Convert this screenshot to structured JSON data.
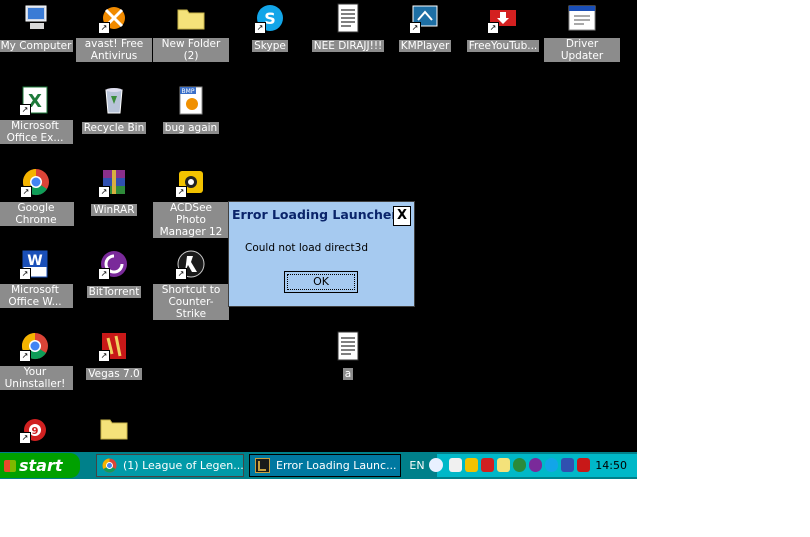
{
  "desktop": {
    "icons": [
      {
        "label": "My Computer",
        "icon": "my-computer-icon",
        "shortcut": false
      },
      {
        "label": "avast! Free Antivirus",
        "icon": "avast-icon",
        "shortcut": true
      },
      {
        "label": "New Folder (2)",
        "icon": "folder-icon",
        "shortcut": false
      },
      {
        "label": "Skype",
        "icon": "skype-icon",
        "shortcut": true
      },
      {
        "label": "NEE DIRAJJ!!!",
        "icon": "text-document-icon",
        "shortcut": false
      },
      {
        "label": "KMPlayer",
        "icon": "kmplayer-icon",
        "shortcut": true
      },
      {
        "label": "FreeYouTub...",
        "icon": "freeyoutube-icon",
        "shortcut": true
      },
      {
        "label": "Driver Updater",
        "icon": "driver-updater-icon",
        "shortcut": false
      },
      {
        "label": "Microsoft Office Ex...",
        "icon": "excel-icon",
        "shortcut": true
      },
      {
        "label": "Recycle Bin",
        "icon": "recycle-bin-icon",
        "shortcut": false
      },
      {
        "label": "bug again",
        "icon": "bmp-image-icon",
        "shortcut": false
      },
      {
        "label": "Google Chrome",
        "icon": "chrome-icon",
        "shortcut": true
      },
      {
        "label": "WinRAR",
        "icon": "winrar-icon",
        "shortcut": true
      },
      {
        "label": "ACDSee Photo Manager 12",
        "icon": "acdsee-icon",
        "shortcut": true
      },
      {
        "label": "Microsoft Office W...",
        "icon": "word-icon",
        "shortcut": true
      },
      {
        "label": "BitTorrent",
        "icon": "bittorrent-icon",
        "shortcut": true
      },
      {
        "label": "Shortcut to Counter-Strike",
        "icon": "counter-strike-icon",
        "shortcut": true
      },
      {
        "label": "Your Uninstaller!",
        "icon": "chrome-icon",
        "shortcut": true
      },
      {
        "label": "Vegas 7.0",
        "icon": "vegas-icon",
        "shortcut": true
      },
      {
        "label": "a",
        "icon": "text-document-icon",
        "shortcut": false
      },
      {
        "label": "",
        "icon": "game-icon",
        "shortcut": true
      },
      {
        "label": "",
        "icon": "folder-icon",
        "shortcut": false
      }
    ]
  },
  "dialog": {
    "title": "Error Loading Launcher",
    "close_label": "X",
    "message": "Could not load direct3d",
    "ok_label": "OK"
  },
  "taskbar": {
    "start_label": "start",
    "buttons": [
      {
        "label": "(1) League of Legen...",
        "icon": "chrome-icon"
      },
      {
        "label": "Error Loading Launc...",
        "icon": "league-launcher-icon"
      }
    ],
    "language": "EN",
    "clock": "14:50"
  },
  "colors": {
    "desktop": "#000000",
    "dialog": "#a6caf0",
    "taskbar": "#00808a",
    "start": "#00a000",
    "tray": "#00b8c8"
  }
}
